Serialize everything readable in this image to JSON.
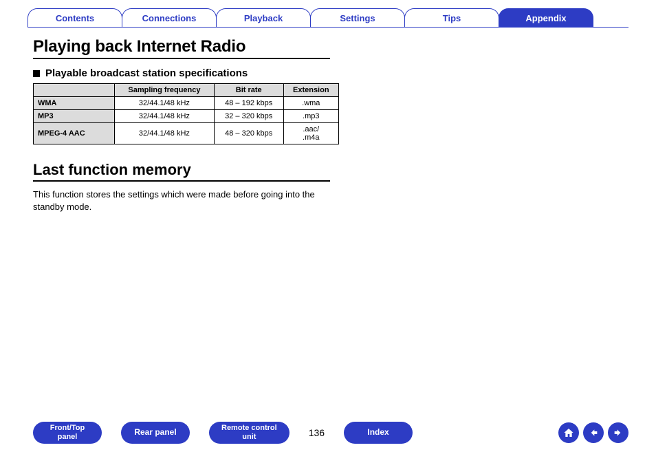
{
  "tabs": [
    {
      "label": "Contents",
      "active": false
    },
    {
      "label": "Connections",
      "active": false
    },
    {
      "label": "Playback",
      "active": false
    },
    {
      "label": "Settings",
      "active": false
    },
    {
      "label": "Tips",
      "active": false
    },
    {
      "label": "Appendix",
      "active": true
    }
  ],
  "heading1": "Playing back Internet Radio",
  "subheading": "Playable broadcast station specifications",
  "table": {
    "headers": [
      "Sampling frequency",
      "Bit rate",
      "Extension"
    ],
    "rows": [
      {
        "label": "WMA",
        "cells": [
          "32/44.1/48 kHz",
          "48 – 192 kbps",
          ".wma"
        ]
      },
      {
        "label": "MP3",
        "cells": [
          "32/44.1/48 kHz",
          "32 – 320 kbps",
          ".mp3"
        ]
      },
      {
        "label": "MPEG-4 AAC",
        "cells": [
          "32/44.1/48 kHz",
          "48 – 320 kbps",
          ".aac/\n.m4a"
        ]
      }
    ]
  },
  "heading2": "Last function memory",
  "body": "This function stores the settings which were made before going into the standby mode.",
  "footer": {
    "buttons": [
      {
        "line1": "Front/Top",
        "line2": "panel"
      },
      {
        "line1": "Rear panel"
      },
      {
        "line1": "Remote control",
        "line2": "unit"
      }
    ],
    "page": "136",
    "indexLabel": "Index"
  },
  "colors": {
    "accent": "#2d3cc4"
  }
}
